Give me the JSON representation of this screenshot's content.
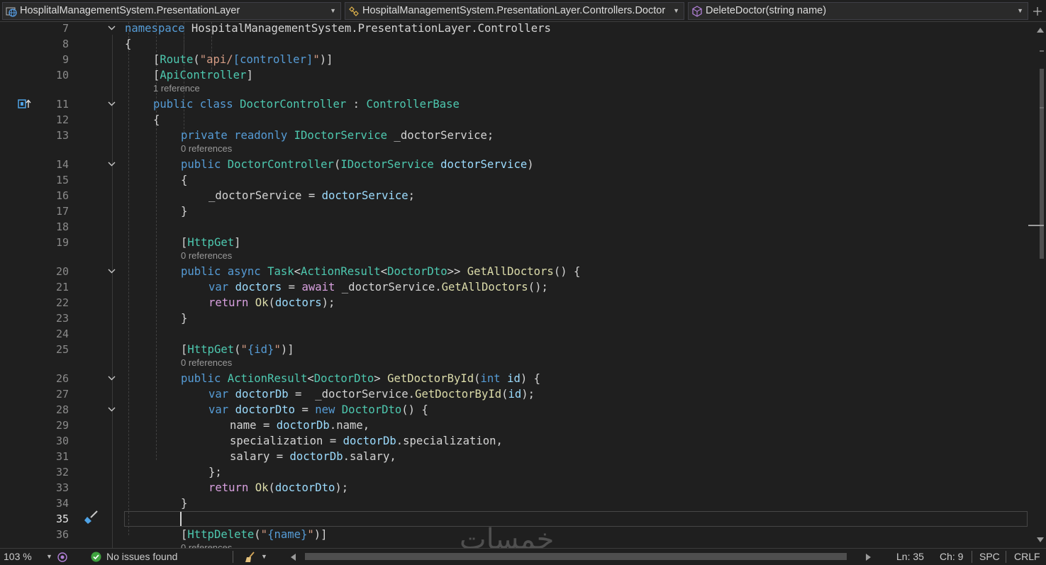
{
  "nav": {
    "project": "HosplitalManagementSystem.PresentationLayer",
    "class": "HospitalManagementSystem.PresentationLayer.Controllers.Doctor",
    "member": "DeleteDoctor(string name)"
  },
  "editor": {
    "current_line": "35",
    "codelens": {
      "one_ref": "1 reference",
      "zero_ref": "0 references"
    },
    "lines": [
      {
        "n": "7",
        "t": [
          [
            "kw",
            "namespace"
          ],
          [
            "plain",
            " HospitalManagementSystem.PresentationLayer.Controllers"
          ]
        ]
      },
      {
        "n": "8",
        "t": [
          [
            "plain",
            "{"
          ]
        ]
      },
      {
        "n": "9",
        "t": [
          [
            "plain",
            "["
          ],
          [
            "typ",
            "Route"
          ],
          [
            "plain",
            "("
          ],
          [
            "str",
            "\"api/"
          ],
          [
            "kw",
            "[controller]"
          ],
          [
            "str",
            "\""
          ],
          [
            "plain",
            ")]"
          ]
        ]
      },
      {
        "n": "10",
        "t": [
          [
            "plain",
            "["
          ],
          [
            "typ",
            "ApiController"
          ],
          [
            "plain",
            "]"
          ]
        ]
      },
      {
        "n": "11",
        "t": [
          [
            "kw",
            "public"
          ],
          [
            "plain",
            " "
          ],
          [
            "kw",
            "class"
          ],
          [
            "plain",
            " "
          ],
          [
            "typ",
            "DoctorController"
          ],
          [
            "plain",
            " : "
          ],
          [
            "typ",
            "ControllerBase"
          ]
        ]
      },
      {
        "n": "12",
        "t": [
          [
            "plain",
            "{"
          ]
        ]
      },
      {
        "n": "13",
        "t": [
          [
            "kw",
            "private"
          ],
          [
            "plain",
            " "
          ],
          [
            "kw",
            "readonly"
          ],
          [
            "plain",
            " "
          ],
          [
            "typ",
            "IDoctorService"
          ],
          [
            "plain",
            " _doctorService;"
          ]
        ]
      },
      {
        "n": "14",
        "t": [
          [
            "kw",
            "public"
          ],
          [
            "plain",
            " "
          ],
          [
            "typ",
            "DoctorController"
          ],
          [
            "plain",
            "("
          ],
          [
            "typ",
            "IDoctorService"
          ],
          [
            "plain",
            " "
          ],
          [
            "var",
            "doctorService"
          ],
          [
            "plain",
            ")"
          ]
        ]
      },
      {
        "n": "15",
        "t": [
          [
            "plain",
            "{"
          ]
        ]
      },
      {
        "n": "16",
        "t": [
          [
            "plain",
            "_doctorService = "
          ],
          [
            "var",
            "doctorService"
          ],
          [
            "plain",
            ";"
          ]
        ]
      },
      {
        "n": "17",
        "t": [
          [
            "plain",
            "}"
          ]
        ]
      },
      {
        "n": "18",
        "t": []
      },
      {
        "n": "19",
        "t": [
          [
            "plain",
            "["
          ],
          [
            "typ",
            "HttpGet"
          ],
          [
            "plain",
            "]"
          ]
        ]
      },
      {
        "n": "20",
        "t": [
          [
            "kw",
            "public"
          ],
          [
            "plain",
            " "
          ],
          [
            "kw",
            "async"
          ],
          [
            "plain",
            " "
          ],
          [
            "typ",
            "Task"
          ],
          [
            "plain",
            "<"
          ],
          [
            "typ",
            "ActionResult"
          ],
          [
            "plain",
            "<"
          ],
          [
            "typ",
            "DoctorDto"
          ],
          [
            "plain",
            ">> "
          ],
          [
            "met",
            "GetAllDoctors"
          ],
          [
            "plain",
            "() {"
          ]
        ]
      },
      {
        "n": "21",
        "t": [
          [
            "kw",
            "var"
          ],
          [
            "plain",
            " "
          ],
          [
            "var",
            "doctors"
          ],
          [
            "plain",
            " = "
          ],
          [
            "ctl",
            "await"
          ],
          [
            "plain",
            " _doctorService."
          ],
          [
            "met",
            "GetAllDoctors"
          ],
          [
            "plain",
            "();"
          ]
        ]
      },
      {
        "n": "22",
        "t": [
          [
            "ctl",
            "return"
          ],
          [
            "plain",
            " "
          ],
          [
            "met",
            "Ok"
          ],
          [
            "plain",
            "("
          ],
          [
            "var",
            "doctors"
          ],
          [
            "plain",
            ");"
          ]
        ]
      },
      {
        "n": "23",
        "t": [
          [
            "plain",
            "}"
          ]
        ]
      },
      {
        "n": "24",
        "t": []
      },
      {
        "n": "25",
        "t": [
          [
            "plain",
            "["
          ],
          [
            "typ",
            "HttpGet"
          ],
          [
            "plain",
            "("
          ],
          [
            "str",
            "\""
          ],
          [
            "kw",
            "{id}"
          ],
          [
            "str",
            "\""
          ],
          [
            "plain",
            ")]"
          ]
        ]
      },
      {
        "n": "26",
        "t": [
          [
            "kw",
            "public"
          ],
          [
            "plain",
            " "
          ],
          [
            "typ",
            "ActionResult"
          ],
          [
            "plain",
            "<"
          ],
          [
            "typ",
            "DoctorDto"
          ],
          [
            "plain",
            "> "
          ],
          [
            "met",
            "GetDoctorById"
          ],
          [
            "plain",
            "("
          ],
          [
            "kw",
            "int"
          ],
          [
            "plain",
            " "
          ],
          [
            "var",
            "id"
          ],
          [
            "plain",
            ") {"
          ]
        ]
      },
      {
        "n": "27",
        "t": [
          [
            "kw",
            "var"
          ],
          [
            "plain",
            " "
          ],
          [
            "var",
            "doctorDb"
          ],
          [
            "plain",
            " =  _doctorService."
          ],
          [
            "met",
            "GetDoctorById"
          ],
          [
            "plain",
            "("
          ],
          [
            "var",
            "id"
          ],
          [
            "plain",
            ");"
          ]
        ]
      },
      {
        "n": "28",
        "t": [
          [
            "kw",
            "var"
          ],
          [
            "plain",
            " "
          ],
          [
            "var",
            "doctorDto"
          ],
          [
            "plain",
            " = "
          ],
          [
            "kw",
            "new"
          ],
          [
            "plain",
            " "
          ],
          [
            "typ",
            "DoctorDto"
          ],
          [
            "plain",
            "() {"
          ]
        ]
      },
      {
        "n": "29",
        "t": [
          [
            "plain",
            "name = "
          ],
          [
            "var",
            "doctorDb"
          ],
          [
            "plain",
            ".name,"
          ]
        ]
      },
      {
        "n": "30",
        "t": [
          [
            "plain",
            "specialization = "
          ],
          [
            "var",
            "doctorDb"
          ],
          [
            "plain",
            ".specialization,"
          ]
        ]
      },
      {
        "n": "31",
        "t": [
          [
            "plain",
            "salary = "
          ],
          [
            "var",
            "doctorDb"
          ],
          [
            "plain",
            ".salary,"
          ]
        ]
      },
      {
        "n": "32",
        "t": [
          [
            "plain",
            "};"
          ]
        ]
      },
      {
        "n": "33",
        "t": [
          [
            "ctl",
            "return"
          ],
          [
            "plain",
            " "
          ],
          [
            "met",
            "Ok"
          ],
          [
            "plain",
            "("
          ],
          [
            "var",
            "doctorDto"
          ],
          [
            "plain",
            ");"
          ]
        ]
      },
      {
        "n": "34",
        "t": [
          [
            "plain",
            "}"
          ]
        ]
      },
      {
        "n": "35",
        "t": []
      },
      {
        "n": "36",
        "t": [
          [
            "plain",
            "["
          ],
          [
            "typ",
            "HttpDelete"
          ],
          [
            "plain",
            "("
          ],
          [
            "str",
            "\""
          ],
          [
            "kw",
            "{name}"
          ],
          [
            "str",
            "\""
          ],
          [
            "plain",
            ")]"
          ]
        ]
      }
    ]
  },
  "status": {
    "zoom": "103 %",
    "issues": "No issues found",
    "line": "Ln: 35",
    "col": "Ch: 9",
    "whitespace": "SPC",
    "eol": "CRLF"
  },
  "watermark": "خمسات",
  "colors": {
    "background": "#1f1f1f",
    "keyword": "#569cd6",
    "control": "#d8a0df",
    "type": "#4ec9b0",
    "string": "#d69d85",
    "method": "#dcdcaa",
    "variable": "#9cdcfe"
  }
}
